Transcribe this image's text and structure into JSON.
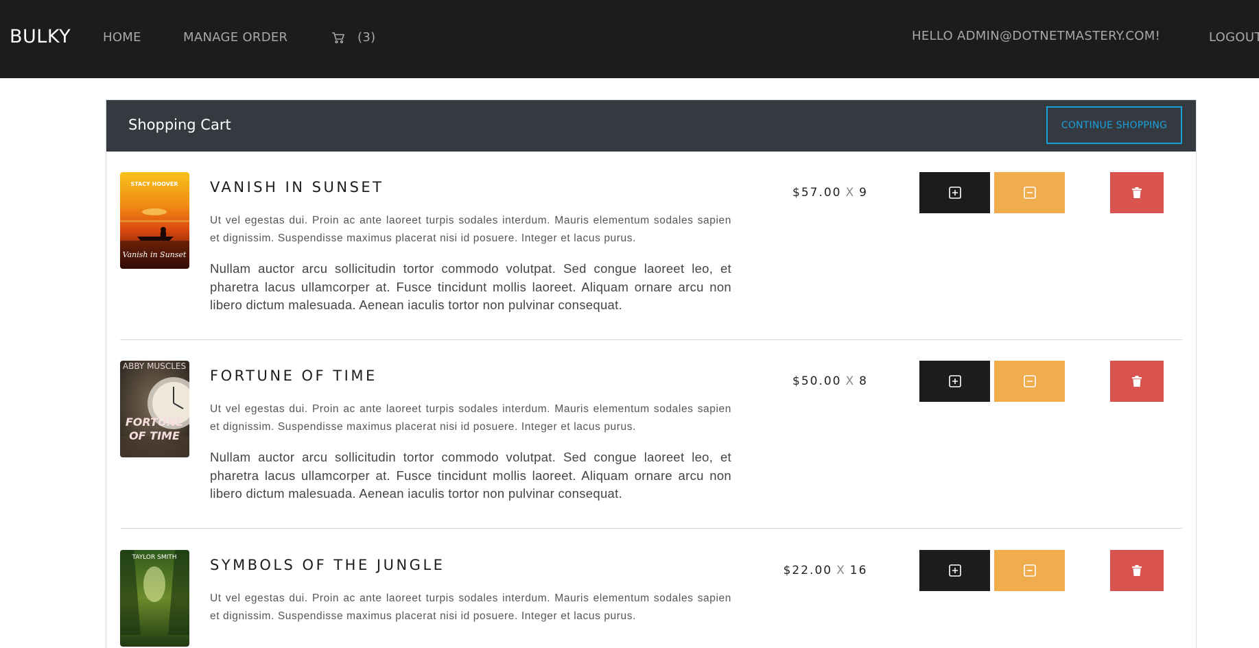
{
  "nav": {
    "brand": "BULKY",
    "home": "HOME",
    "manage_order": "MANAGE ORDER",
    "cart_count": "(3)",
    "greeting": "HELLO ADMIN@DOTNETMASTERY.COM!",
    "logout": "LOGOUT"
  },
  "cart": {
    "title": "Shopping Cart",
    "continue_label": "CONTINUE SHOPPING",
    "items": [
      {
        "title": "VANISH IN SUNSET",
        "cover_author": "STACY HOOVER",
        "cover_title": "Vanish in Sunset",
        "desc1": "Ut vel egestas dui. Proin ac ante laoreet turpis sodales interdum. Mauris elementum sodales sapien et dignissim. Suspendisse maximus placerat nisi id posuere. Integer et lacus purus.",
        "desc2": "Nullam auctor arcu sollicitudin tortor commodo volutpat. Sed congue laoreet leo, et pharetra lacus ullamcorper at. Fusce tincidunt mollis laoreet. Aliquam ornare arcu non libero dictum malesuada. Aenean iaculis tortor non pulvinar consequat.",
        "price": "$57.00",
        "x": "X",
        "qty": "9"
      },
      {
        "title": "FORTUNE OF TIME",
        "cover_author": "ABBY MUSCLES",
        "cover_title_1": "FORTUNE",
        "cover_title_2": "OF TIME",
        "desc1": "Ut vel egestas dui. Proin ac ante laoreet turpis sodales interdum. Mauris elementum sodales sapien et dignissim. Suspendisse maximus placerat nisi id posuere. Integer et lacus purus.",
        "desc2": "Nullam auctor arcu sollicitudin tortor commodo volutpat. Sed congue laoreet leo, et pharetra lacus ullamcorper at. Fusce tincidunt mollis laoreet. Aliquam ornare arcu non libero dictum malesuada. Aenean iaculis tortor non pulvinar consequat.",
        "price": "$50.00",
        "x": "X",
        "qty": "8"
      },
      {
        "title": "SYMBOLS OF THE JUNGLE",
        "cover_author": "TAYLOR SMITH",
        "desc1": "Ut vel egestas dui. Proin ac ante laoreet turpis sodales interdum. Mauris elementum sodales sapien et dignissim. Suspendisse maximus placerat nisi id posuere. Integer et lacus purus.",
        "price": "$22.00",
        "x": "X",
        "qty": "16"
      }
    ]
  },
  "colors": {
    "navbar": "#1c1c1c",
    "header": "#343a40",
    "accent": "#1b9fdb",
    "plus": "#1c1c1c",
    "minus": "#f0ad4e",
    "delete": "#d9534f"
  },
  "icons": {
    "cart": "cart-icon",
    "plus": "plus-square-icon",
    "minus": "minus-square-icon",
    "delete": "trash-icon"
  }
}
